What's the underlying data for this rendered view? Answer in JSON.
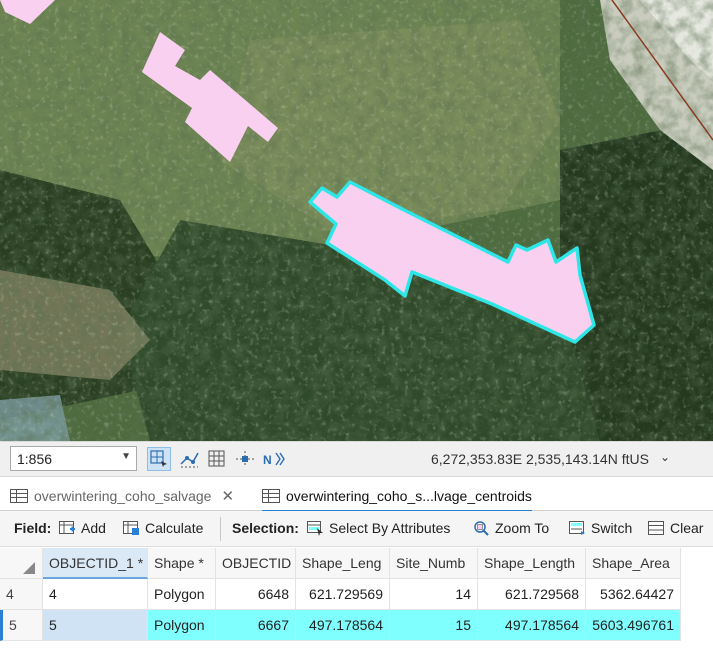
{
  "map": {
    "colors": {
      "feature_fill": "#f9d0f0",
      "selection_outline": "#2ee6e6"
    }
  },
  "status_bar": {
    "scale": "1:856",
    "coordinates": "6,272,353.83E 2,535,143.14N ftUS"
  },
  "tabs": [
    {
      "label": "overwintering_coho_salvage",
      "active": false
    },
    {
      "label": "overwintering_coho_s...lvage_centroids",
      "active": true
    }
  ],
  "toolbar": {
    "field_label": "Field:",
    "add_label": "Add",
    "calculate_label": "Calculate",
    "selection_label": "Selection:",
    "select_by_attributes_label": "Select By Attributes",
    "zoom_to_label": "Zoom To",
    "switch_label": "Switch",
    "clear_label": "Clear"
  },
  "table": {
    "columns": [
      "OBJECTID_1 *",
      "Shape *",
      "OBJECTID",
      "Shape_Leng",
      "Site_Numb",
      "Shape_Length",
      "Shape_Area"
    ],
    "rows": [
      {
        "row_number": "4",
        "cells": [
          "4",
          "Polygon",
          "6648",
          "621.729569",
          "14",
          "621.729568",
          "5362.64427"
        ],
        "selected": false
      },
      {
        "row_number": "5",
        "cells": [
          "5",
          "Polygon",
          "6667",
          "497.178564",
          "15",
          "497.178564",
          "5603.496761"
        ],
        "selected": true
      }
    ]
  }
}
